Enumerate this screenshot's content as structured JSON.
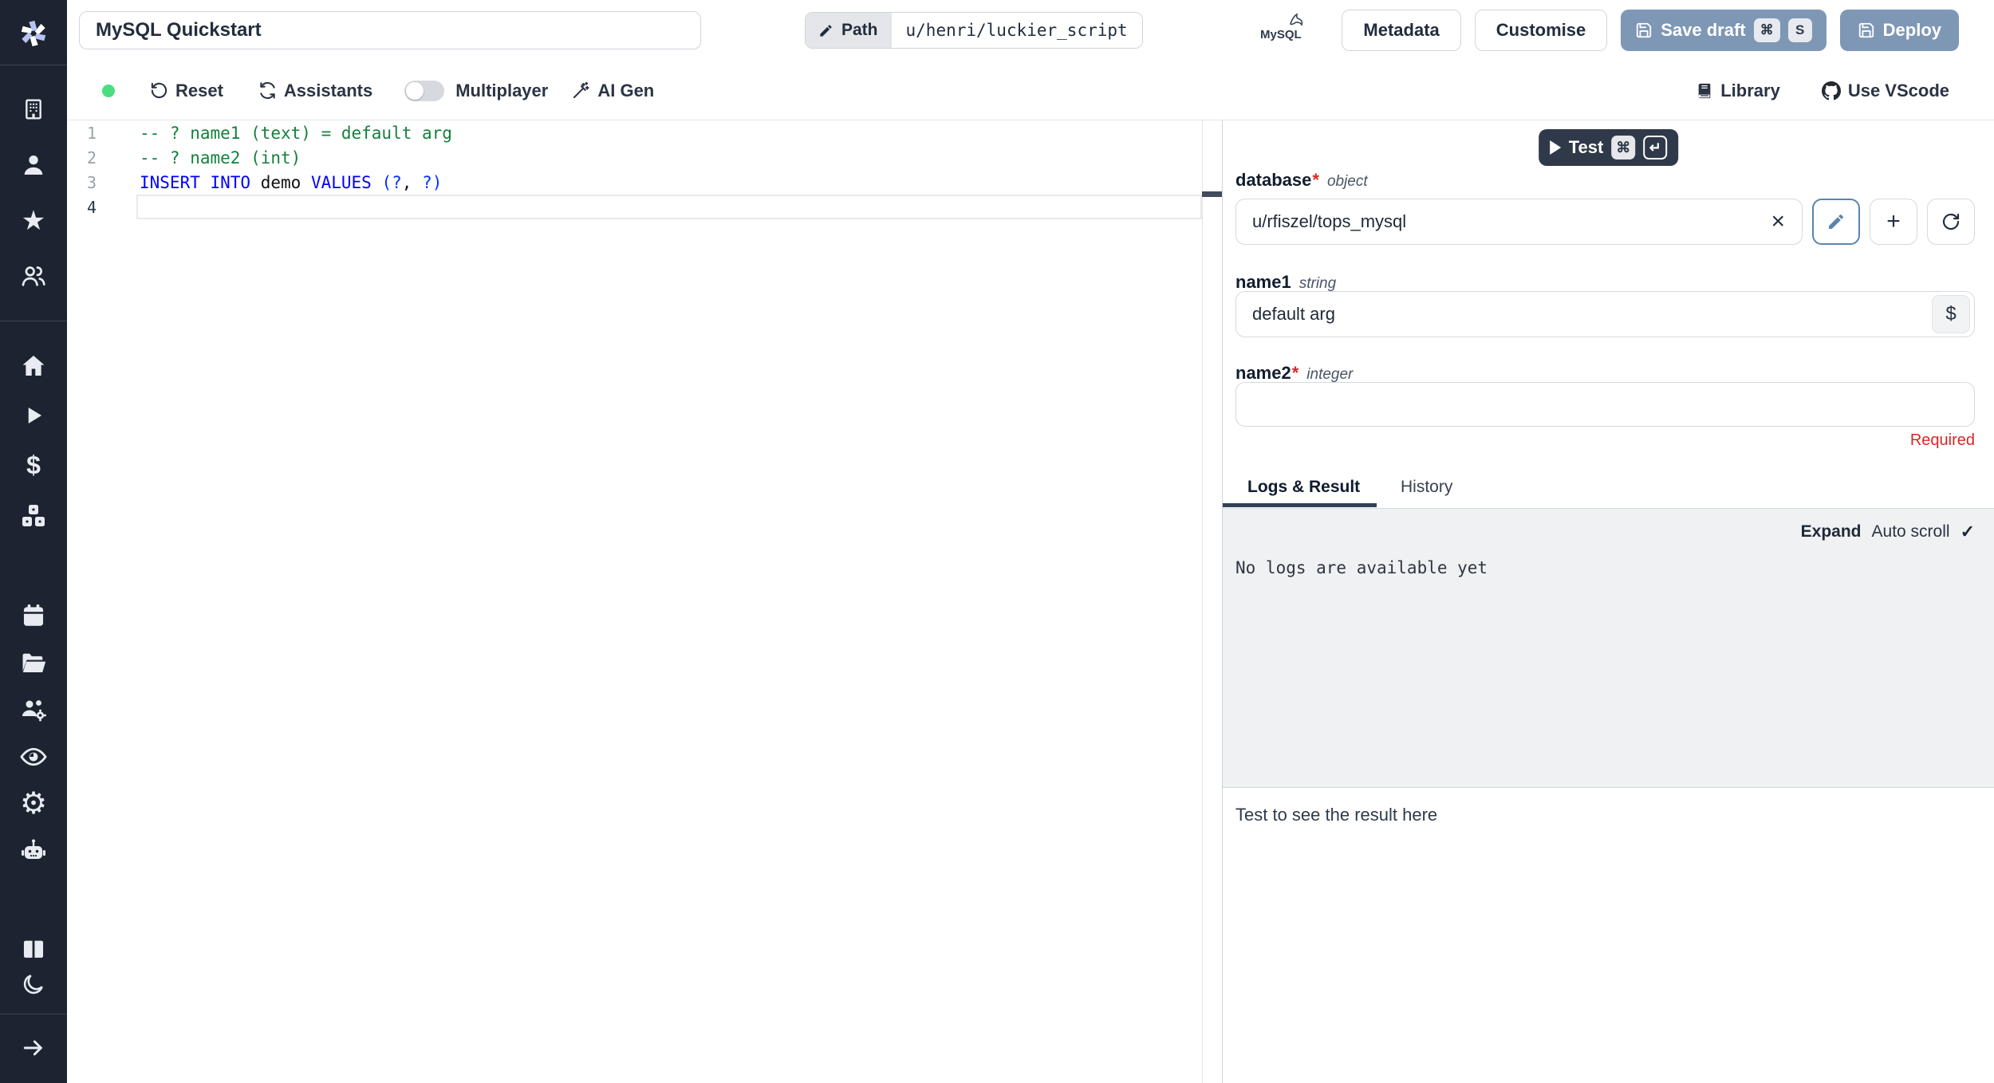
{
  "topbar": {
    "title_value": "MySQL Quickstart",
    "path_label": "Path",
    "path_value": "u/henri/luckier_script",
    "language_logo_text": "MySQL",
    "metadata_label": "Metadata",
    "customise_label": "Customise",
    "save_draft_label": "Save draft",
    "save_draft_kbd_1": "⌘",
    "save_draft_kbd_2": "S",
    "deploy_label": "Deploy"
  },
  "toolbar": {
    "reset_label": "Reset",
    "assistants_label": "Assistants",
    "multiplayer_label": "Multiplayer",
    "multiplayer_on": false,
    "ai_gen_label": "AI Gen",
    "library_label": "Library",
    "vscode_label": "Use VScode"
  },
  "editor": {
    "line_numbers": [
      "1",
      "2",
      "3",
      "4"
    ],
    "line1_comment": "-- ? name1 (text) = default arg",
    "line2_comment": "-- ? name2 (int)",
    "line3": {
      "kw1": "INSERT INTO",
      "sp1": " ",
      "ident": "demo",
      "sp2": " ",
      "kw2": "VALUES",
      "sp3": " ",
      "open": "(?",
      "comma": ", ",
      "close": "?)"
    }
  },
  "run_panel": {
    "test_label": "Test",
    "test_kbd_cmd": "⌘",
    "test_kbd_enter": "↵",
    "database_field": {
      "label": "database",
      "required_marker": "*",
      "type": "object",
      "value": "u/rfiszel/tops_mysql"
    },
    "name1_field": {
      "label": "name1",
      "type": "string",
      "value": "default arg",
      "dollar_label": "$"
    },
    "name2_field": {
      "label": "name2",
      "required_marker": "*",
      "type": "integer",
      "value": "",
      "error": "Required"
    },
    "tabs": {
      "logs": "Logs & Result",
      "history": "History"
    },
    "logs_panel": {
      "expand_label": "Expand",
      "autoscroll_label": "Auto scroll",
      "autoscroll_check": "✓",
      "empty_text": "No logs are available yet"
    },
    "result_placeholder": "Test to see the result here"
  },
  "sidebar": {
    "items": [
      "workspace",
      "user",
      "favorites",
      "groups",
      "home",
      "runs",
      "variables",
      "resources",
      "schedules",
      "folders",
      "workers",
      "audit-logs",
      "settings",
      "ai",
      "docs",
      "dark-mode",
      "collapse"
    ]
  },
  "icons": {
    "star": "★",
    "dollar": "$",
    "gear": "⚙",
    "clear": "×",
    "plus": "+"
  },
  "colors": {
    "accent_blue": "#7e97b5",
    "sidebar_bg": "#1d2330",
    "status_green": "#4ade80",
    "danger_red": "#dc2626",
    "test_button_bg": "#2f3949",
    "keyword_blue": "#0000ff",
    "comment_green": "#15803d"
  }
}
